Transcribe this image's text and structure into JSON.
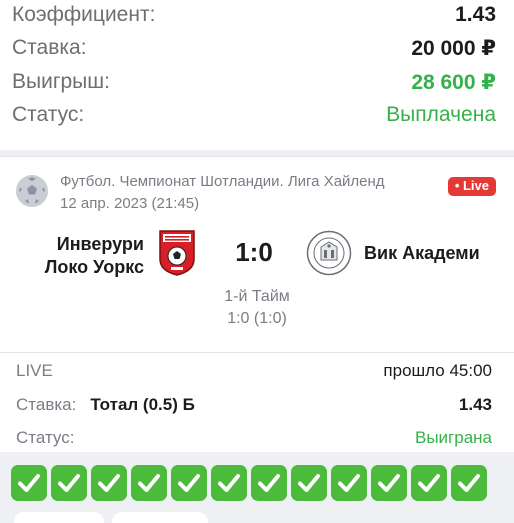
{
  "summary": {
    "coef_label": "Коэффициент:",
    "coef_value": "1.43",
    "stake_label": "Ставка:",
    "stake_value": "20 000 ₽",
    "win_label": "Выигрыш:",
    "win_value": "28 600 ₽",
    "status_label": "Статус:",
    "status_value": "Выплачена"
  },
  "card": {
    "league": "Футбол. Чемпионат Шотландии. Лига Хайленд",
    "date": "12 апр. 2023 (21:45)",
    "live_badge": "• Live",
    "home_team_line1": "Инверури",
    "home_team_line2": "Локо Уоркс",
    "score": "1:0",
    "away_team": "Вик Академи",
    "period": "1-й Тайм",
    "period_score": "1:0 (1:0)",
    "live_label": "LIVE",
    "elapsed": "прошло 45:00",
    "bet_label": "Ставка:",
    "bet_value": "Тотал (0.5) Б",
    "bet_coef": "1.43",
    "status_label": "Статус:",
    "status_value": "Выиграна"
  },
  "checks": {
    "count": 12,
    "icon": "check-mark-icon"
  },
  "colors": {
    "green": "#34b14a",
    "check_bg": "#4cbb3c",
    "live_red": "#e53935",
    "muted": "#7a7d85"
  }
}
